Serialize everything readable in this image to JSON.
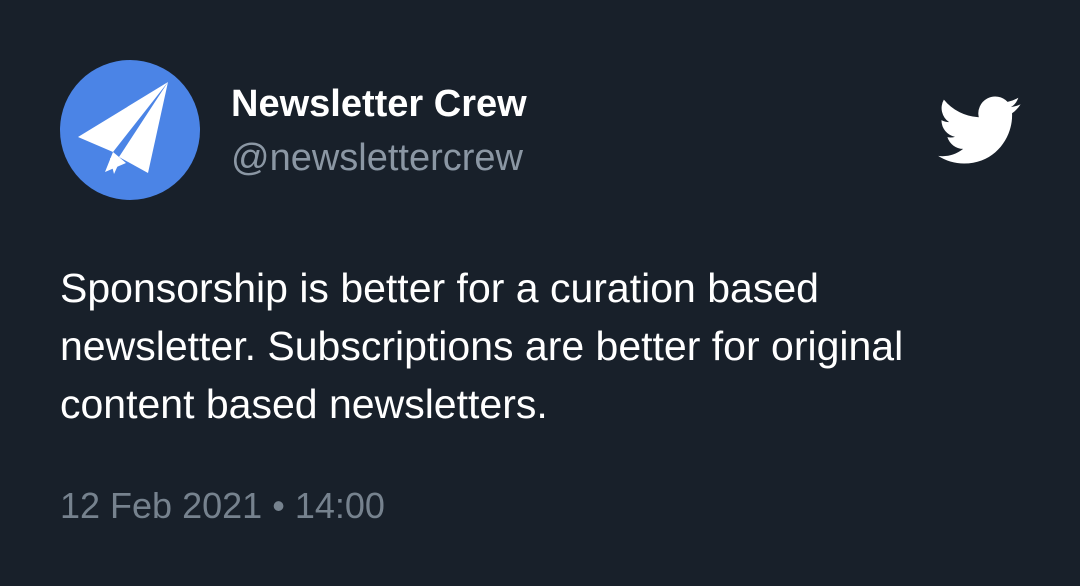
{
  "tweet": {
    "author": {
      "name": "Newsletter Crew",
      "handle": "@newslettercrew",
      "avatar_icon": "paper-plane-icon",
      "avatar_color": "#4b84e6"
    },
    "brand_icon": "twitter-bird-icon",
    "text_lines": [
      "Sponsorship is better for a curation based",
      "newsletter. Subscriptions are better for original",
      "content based newsletters."
    ],
    "date": "12 Feb 2021",
    "separator": "•",
    "time": "14:00"
  },
  "colors": {
    "background": "#18202a",
    "text_primary": "#ffffff",
    "text_secondary": "#8b97a4",
    "text_meta": "#76828e"
  }
}
